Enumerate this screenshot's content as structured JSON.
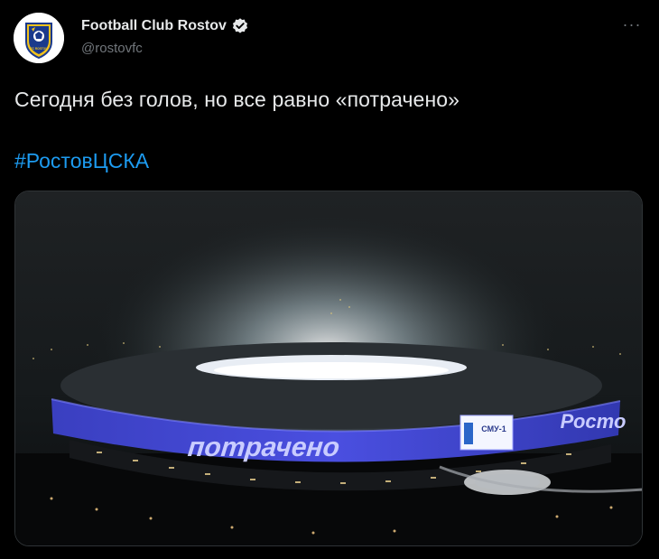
{
  "author": {
    "display_name": "Football Club Rostov",
    "handle": "@rostovfc",
    "verified_icon": "verified-badge-icon",
    "avatar_icon": "club-crest-icon",
    "crest_text": "FC ROSTOV"
  },
  "more_icon": "more-options-icon",
  "tweet": {
    "text": "Сегодня без голов, но все равно «потрачено»",
    "hashtag": "#РостовЦСКА"
  },
  "media": {
    "facade_text": "потрачено",
    "facade_text_right": "Росто",
    "sign_text": "СМУ-1"
  },
  "colors": {
    "background": "#000000",
    "text": "#e7e9ea",
    "secondary": "#71767b",
    "link": "#1d9bf0",
    "crest_blue": "#1a3a8c",
    "crest_yellow": "#f2c21b"
  }
}
